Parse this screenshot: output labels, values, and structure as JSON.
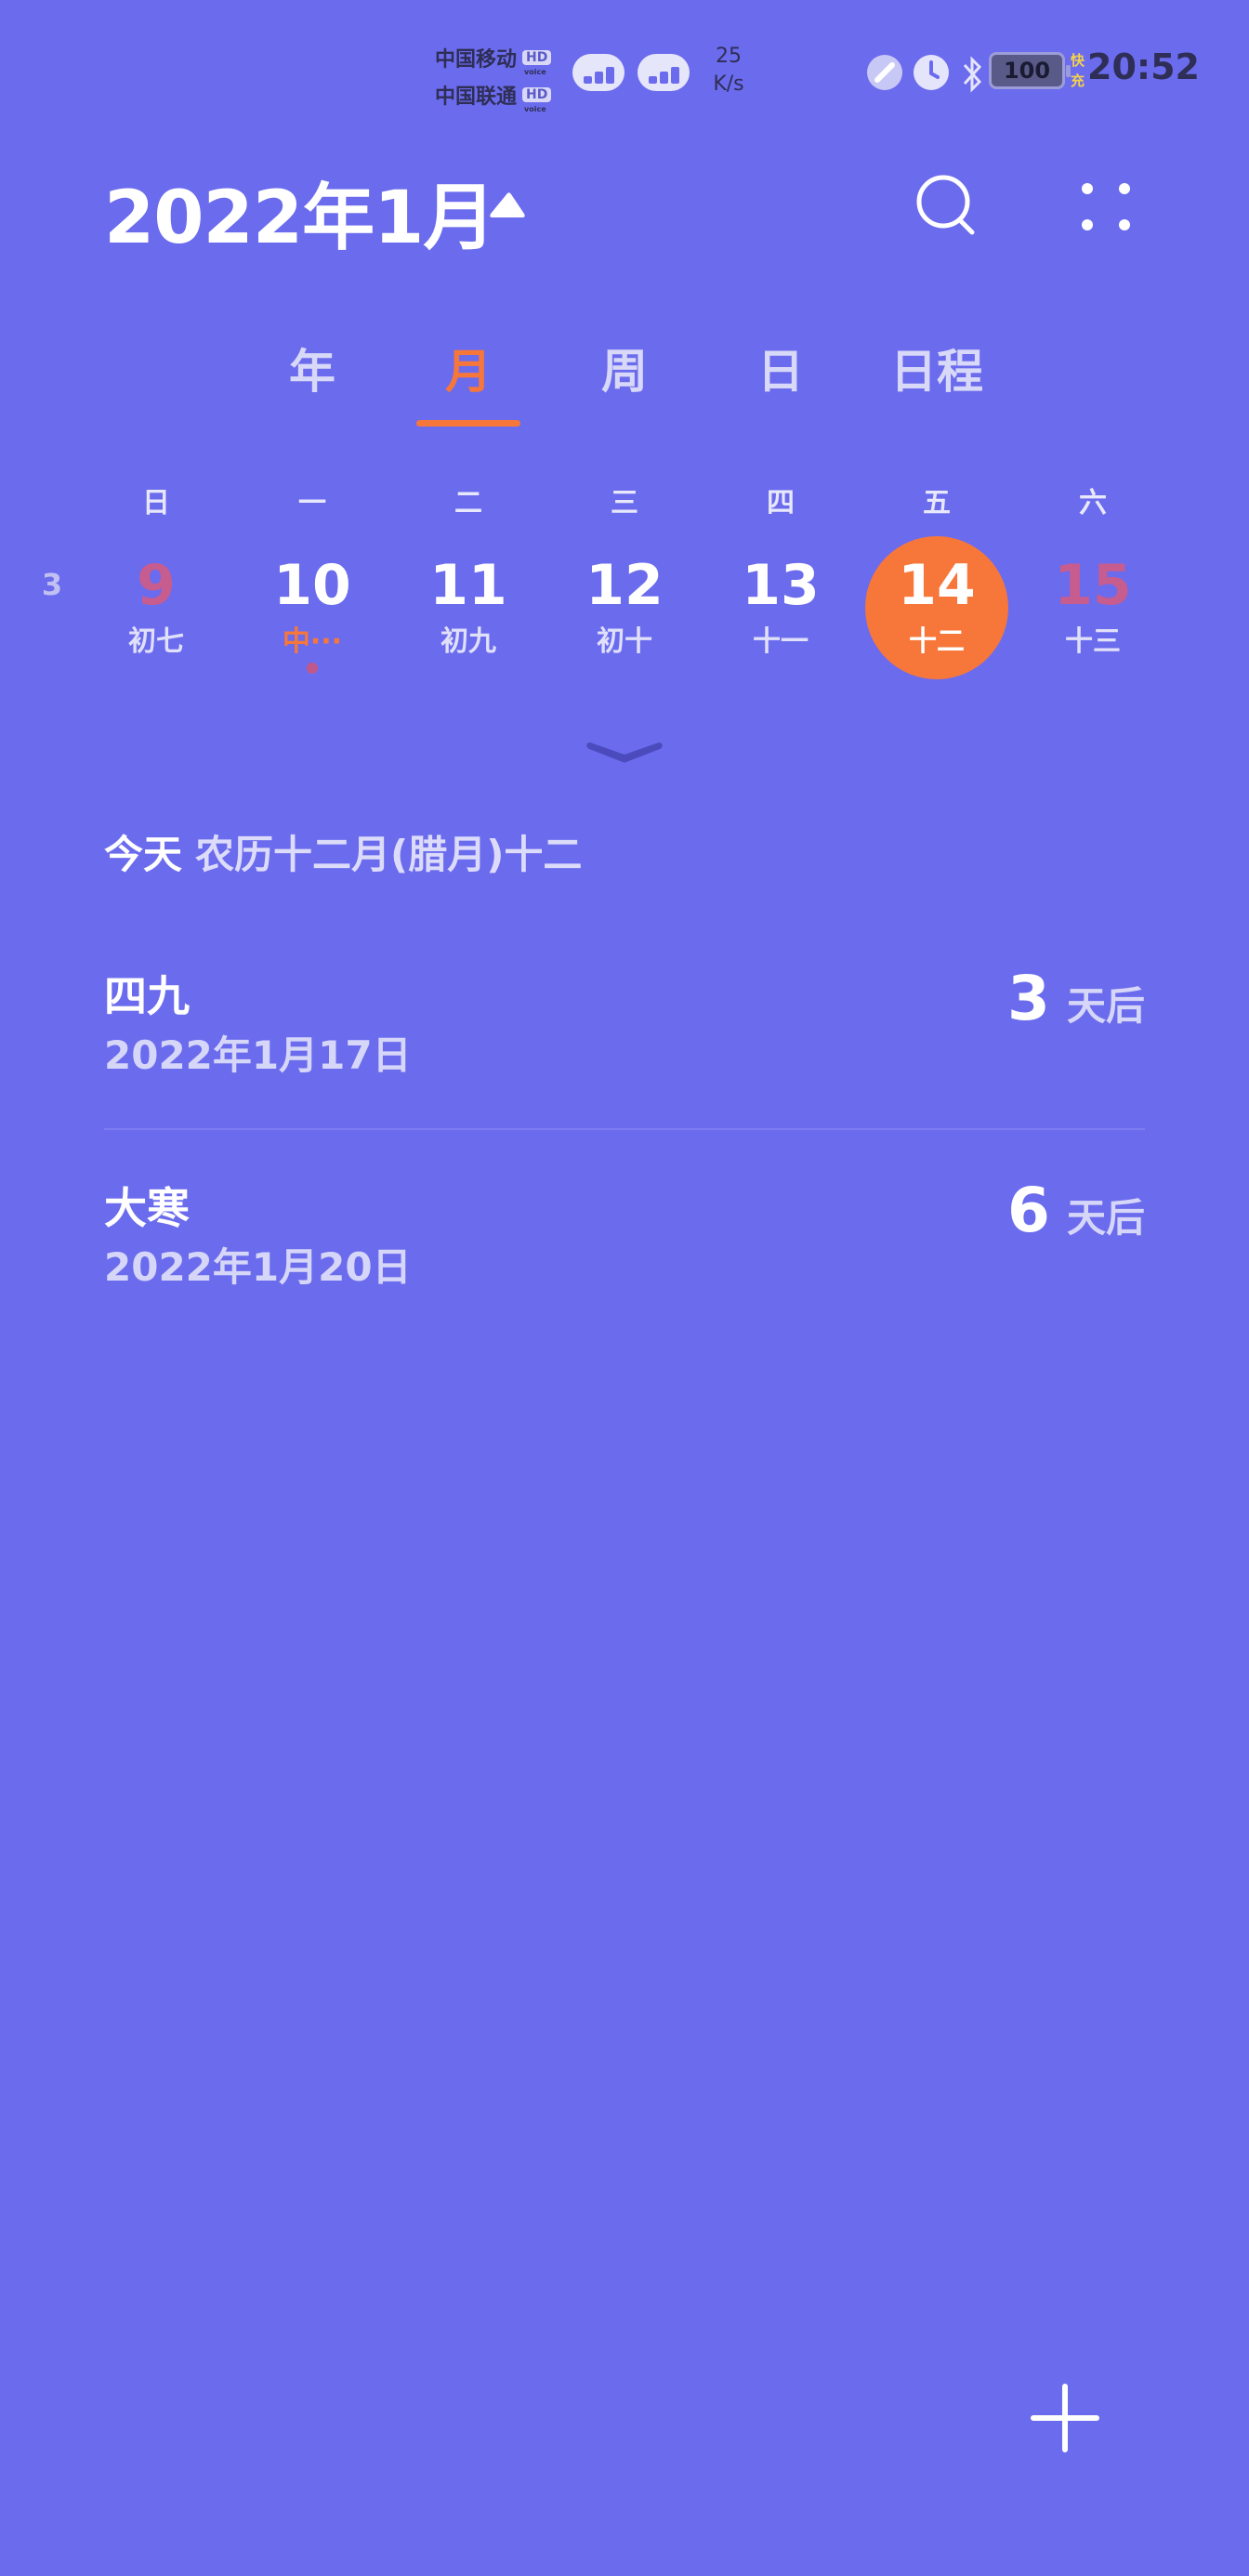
{
  "status_bar": {
    "carrier1": "中国移动",
    "carrier2": "中国联通",
    "hd_label": "HD",
    "speed_value": "25",
    "speed_unit": "K/s",
    "battery": "100",
    "charge_label": "快充",
    "time": "20:52",
    "icons": [
      "link-icon",
      "alarm-icon",
      "bluetooth-icon",
      "battery-icon"
    ]
  },
  "header": {
    "title": "2022年1月",
    "toggle_icon": "triangle-up-icon",
    "search_icon": "search-icon",
    "more_icon": "more-dots-icon"
  },
  "tabs": [
    {
      "label": "年",
      "active": false
    },
    {
      "label": "月",
      "active": true
    },
    {
      "label": "周",
      "active": false
    },
    {
      "label": "日",
      "active": false
    },
    {
      "label": "日程",
      "active": false
    }
  ],
  "weekdays": [
    "日",
    "一",
    "二",
    "三",
    "四",
    "五",
    "六"
  ],
  "week": {
    "number": "3",
    "days": [
      {
        "num": "9",
        "lunar": "初七",
        "weekend": true
      },
      {
        "num": "10",
        "lunar": "中···",
        "festival": true,
        "has_event": true
      },
      {
        "num": "11",
        "lunar": "初九"
      },
      {
        "num": "12",
        "lunar": "初十"
      },
      {
        "num": "13",
        "lunar": "十一"
      },
      {
        "num": "14",
        "lunar": "十二",
        "today": true
      },
      {
        "num": "15",
        "lunar": "十三",
        "weekend": true
      }
    ]
  },
  "today": {
    "label": "今天",
    "lunar": "农历十二月(腊月)十二"
  },
  "events": [
    {
      "title": "四九",
      "date": "2022年1月17日",
      "days": "3",
      "unit": "天后"
    },
    {
      "title": "大寒",
      "date": "2022年1月20日",
      "days": "6",
      "unit": "天后"
    }
  ],
  "fab_icon": "plus-icon",
  "colors": {
    "background": "#6b6bee",
    "accent": "#f7773a",
    "weekend": "#c75c8e"
  }
}
